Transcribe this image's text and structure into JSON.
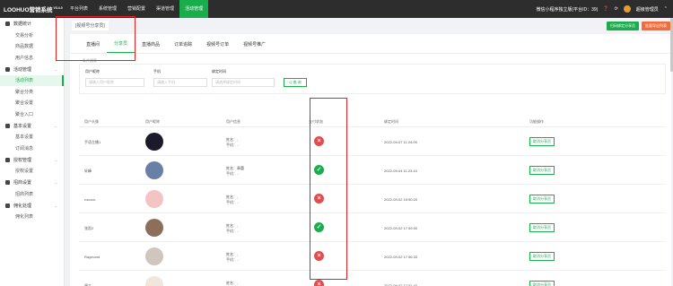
{
  "topbar": {
    "logo": "LOOHUO营销系统",
    "version": "V3.4.0",
    "nav": [
      "平台列表",
      "系统管理",
      "营销配置",
      "渠道管理",
      "活动管理"
    ],
    "active_index": 4,
    "platform": "微信小程序独立版(平台ID：39)",
    "user": "超级管理员"
  },
  "sidebar": [
    {
      "type": "group",
      "label": "数据统计"
    },
    {
      "type": "item",
      "label": "交易分析"
    },
    {
      "type": "item",
      "label": "商品数据"
    },
    {
      "type": "item",
      "label": "用户信息"
    },
    {
      "type": "group",
      "label": "活动管理"
    },
    {
      "type": "item",
      "label": "活动列表",
      "active": true
    },
    {
      "type": "item",
      "label": "聚合分类"
    },
    {
      "type": "item",
      "label": "聚合设置"
    },
    {
      "type": "item",
      "label": "聚合入口"
    },
    {
      "type": "group",
      "label": "基本设置"
    },
    {
      "type": "item",
      "label": "基本设置"
    },
    {
      "type": "item",
      "label": "订阅消息"
    },
    {
      "type": "group",
      "label": "授权管理"
    },
    {
      "type": "item",
      "label": "授权设置"
    },
    {
      "type": "group",
      "label": "招商设置"
    },
    {
      "type": "item",
      "label": "招商列表"
    },
    {
      "type": "group",
      "label": "佣化处理"
    },
    {
      "type": "item",
      "label": "佣化列表"
    }
  ],
  "breadcrumb": "[视频号分享员]",
  "header_buttons": {
    "green": "扫码绑定分享员",
    "orange": "批量导出列表"
  },
  "tabs": [
    "直播间",
    "分享员",
    "直播商品",
    "订单追踪",
    "视频号订单",
    "视频号推广"
  ],
  "active_tab": 1,
  "filter": {
    "title": "条件搜索",
    "nickname_label": "用户昵称",
    "nickname_placeholder": "请输入用户昵称",
    "phone_label": "手机",
    "phone_placeholder": "请输入手机",
    "time_label": "绑定时间",
    "time_placeholder": "请选择绑定时间",
    "query_button": "Q 查 询"
  },
  "table": {
    "headers": [
      "用户头像",
      "用户昵称",
      "用户信息",
      "支付状态",
      "绑定时间",
      "功能操作"
    ],
    "rows": [
      {
        "name": "手语主播1",
        "info": [
          "姓名：-",
          "手机：-"
        ],
        "status": "fail",
        "time": "2022-09-07 11:24:09",
        "action": "取消分享员"
      },
      {
        "name": "轩峰",
        "info": [
          "姓名：章蕾",
          "手机：-"
        ],
        "status": "ok",
        "time": "2022-09-04 11:23:44",
        "action": "取消分享员"
      },
      {
        "name": "rococo.",
        "info": [
          "姓名：-",
          "手机：-"
        ],
        "status": "fail",
        "time": "2022-09-02 15:50:20",
        "action": "取消分享员"
      },
      {
        "name": "张凯2",
        "info": [
          "姓名：-",
          "手机：-"
        ],
        "status": "ok",
        "time": "2022-09-02 17:59:00",
        "action": "取消分享员"
      },
      {
        "name": "Raymond",
        "info": [
          "姓名：-",
          "手机：-"
        ],
        "status": "fail",
        "time": "2022-09-02 17:56:33",
        "action": "取消分享员"
      },
      {
        "name": "周立",
        "info": [
          "姓名：-",
          "手机：-"
        ],
        "status": "fail",
        "time": "2022-09-02 17:51:42",
        "action": "取消分享员"
      }
    ]
  },
  "colors": {
    "accent": "#1aad4c",
    "fail": "#e74c4c",
    "highlight": "#e52121"
  }
}
